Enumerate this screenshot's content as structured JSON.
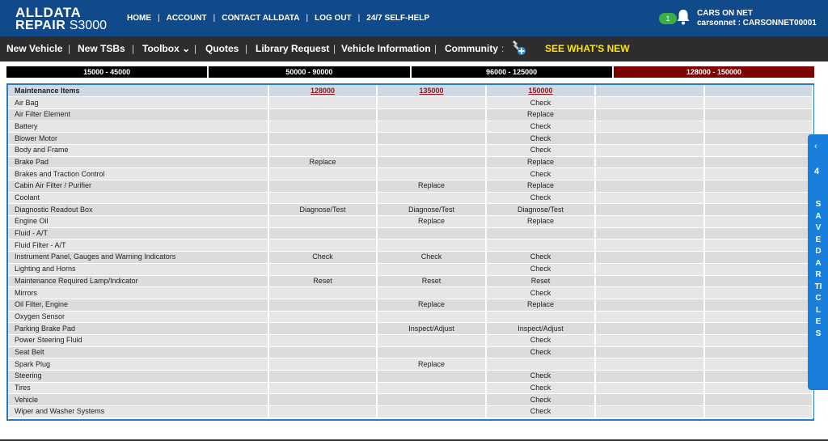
{
  "brand": {
    "line1": "ALLDATA",
    "line2_bold": "REPAIR",
    "line2_normal": "S3000"
  },
  "topnav": [
    "HOME",
    "ACCOUNT",
    "CONTACT ALLDATA",
    "LOG OUT",
    "24/7 SELF-HELP"
  ],
  "notifications": {
    "count": "1"
  },
  "user": {
    "shop": "CARS ON NET",
    "account": "carsonnet : CARSONNET00001"
  },
  "mainnav": {
    "new_vehicle": "New Vehicle",
    "new_tsbs": "New TSBs",
    "toolbox": "Toolbox ⌄",
    "quotes": "Quotes",
    "library_request": "Library Request",
    "vehicle_information": "Vehicle Information",
    "community": "Community",
    "whats_new": "SEE WHAT'S NEW"
  },
  "mileage_ranges": [
    "15000 - 45000",
    "50000 - 90000",
    "96000 - 125000",
    "128000 - 150000"
  ],
  "table": {
    "header_label": "Maintenance Items",
    "mileages": [
      "128000",
      "135000",
      "150000"
    ],
    "rows": [
      {
        "item": "Air Bag",
        "v": [
          "",
          "",
          "Check"
        ]
      },
      {
        "item": "Air Filter Element",
        "v": [
          "",
          "",
          "Replace"
        ]
      },
      {
        "item": "Battery",
        "v": [
          "",
          "",
          "Check"
        ]
      },
      {
        "item": "Blower Motor",
        "v": [
          "",
          "",
          "Check"
        ]
      },
      {
        "item": "Body and Frame",
        "v": [
          "",
          "",
          "Check"
        ]
      },
      {
        "item": "Brake Pad",
        "v": [
          "Replace",
          "",
          "Replace"
        ]
      },
      {
        "item": "Brakes and Traction Control",
        "v": [
          "",
          "",
          "Check"
        ]
      },
      {
        "item": "Cabin Air Filter / Purifier",
        "v": [
          "",
          "Replace",
          "Replace"
        ]
      },
      {
        "item": "Coolant",
        "v": [
          "",
          "",
          "Check"
        ]
      },
      {
        "item": "Diagnostic Readout Box",
        "v": [
          "Diagnose/Test",
          "Diagnose/Test",
          "Diagnose/Test"
        ]
      },
      {
        "item": "Engine Oil",
        "v": [
          "",
          "Replace",
          "Replace"
        ]
      },
      {
        "item": "Fluid - A/T",
        "v": [
          "",
          "",
          ""
        ]
      },
      {
        "item": "Fluid Filter - A/T",
        "v": [
          "",
          "",
          ""
        ]
      },
      {
        "item": "Instrument Panel, Gauges and Warning Indicators",
        "v": [
          "Check",
          "Check",
          "Check"
        ]
      },
      {
        "item": "Lighting and Horns",
        "v": [
          "",
          "",
          "Check"
        ]
      },
      {
        "item": "Maintenance Required Lamp/Indicator",
        "v": [
          "Reset",
          "Reset",
          "Reset"
        ]
      },
      {
        "item": "Mirrors",
        "v": [
          "",
          "",
          "Check"
        ]
      },
      {
        "item": "Oil Filter, Engine",
        "v": [
          "",
          "Replace",
          "Replace"
        ]
      },
      {
        "item": "Oxygen Sensor",
        "v": [
          "",
          "",
          ""
        ]
      },
      {
        "item": "Parking Brake Pad",
        "v": [
          "",
          "Inspect/Adjust",
          "Inspect/Adjust"
        ]
      },
      {
        "item": "Power Steering Fluid",
        "v": [
          "",
          "",
          "Check"
        ]
      },
      {
        "item": "Seat Belt",
        "v": [
          "",
          "",
          "Check"
        ]
      },
      {
        "item": "Spark Plug",
        "v": [
          "",
          "Replace",
          ""
        ]
      },
      {
        "item": "Steering",
        "v": [
          "",
          "",
          "Check"
        ]
      },
      {
        "item": "Tires",
        "v": [
          "",
          "",
          "Check"
        ]
      },
      {
        "item": "Vehicle",
        "v": [
          "",
          "",
          "Check"
        ]
      },
      {
        "item": "Wiper and Washer Systems",
        "v": [
          "",
          "",
          "Check"
        ]
      }
    ]
  },
  "saved_articles": {
    "count": "4",
    "label": "SAVEDARTICLES"
  },
  "colors": {
    "header_blue": "#104a8a",
    "nav_dark": "#2d2d2d",
    "accent_yellow": "#ffe600",
    "active_range": "#7d0303",
    "tab_blue": "#1a7fdc"
  }
}
